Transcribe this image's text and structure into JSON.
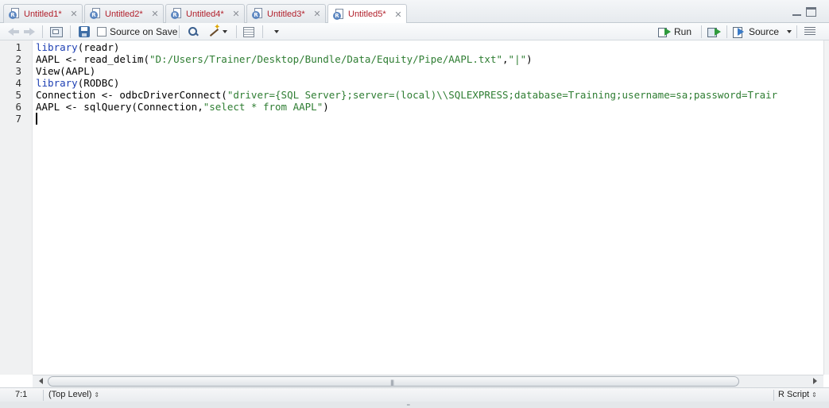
{
  "tabs": [
    {
      "label": "Untitled1*",
      "active": false
    },
    {
      "label": "Untitled2*",
      "active": false
    },
    {
      "label": "Untitled4*",
      "active": false
    },
    {
      "label": "Untitled3*",
      "active": false
    },
    {
      "label": "Untitled5*",
      "active": true
    }
  ],
  "toolbar": {
    "source_on_save": "Source on Save",
    "source_on_save_checked": false,
    "run_label": "Run",
    "source_label": "Source"
  },
  "editor": {
    "line_numbers": [
      "1",
      "2",
      "3",
      "4",
      "5",
      "6",
      "7"
    ],
    "lines": [
      [
        {
          "t": "library",
          "c": "kw"
        },
        {
          "t": "(readr)",
          "c": ""
        }
      ],
      [
        {
          "t": "AAPL <- read_delim(",
          "c": ""
        },
        {
          "t": "\"D:/Users/Trainer/Desktop/Bundle/Data/Equity/Pipe/AAPL.txt\"",
          "c": "str"
        },
        {
          "t": ",",
          "c": ""
        },
        {
          "t": "\"|\"",
          "c": "str"
        },
        {
          "t": ")",
          "c": ""
        }
      ],
      [
        {
          "t": "View(AAPL)",
          "c": ""
        }
      ],
      [
        {
          "t": "library",
          "c": "kw"
        },
        {
          "t": "(RODBC)",
          "c": ""
        }
      ],
      [
        {
          "t": "Connection <- odbcDriverConnect(",
          "c": ""
        },
        {
          "t": "\"driver={SQL Server};server=(local)\\\\SQLEXPRESS;database=Training;username=sa;password=Trair",
          "c": "str"
        }
      ],
      [
        {
          "t": "AAPL <- sqlQuery(Connection,",
          "c": ""
        },
        {
          "t": "\"select * from AAPL\"",
          "c": "str"
        },
        {
          "t": ")",
          "c": ""
        }
      ],
      []
    ],
    "cursor_line": 7
  },
  "status": {
    "position": "7:1",
    "scope": "(Top Level)",
    "file_type": "R Script"
  },
  "colors": {
    "keyword": "#1d3fb3",
    "string": "#2e7d32",
    "tab_label": "#b1202b"
  }
}
